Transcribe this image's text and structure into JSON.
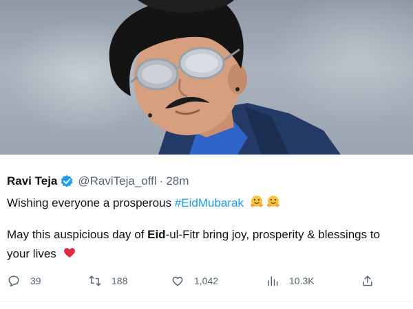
{
  "tweet": {
    "author_name": "Ravi Teja",
    "handle": "@RaviTeja_offl",
    "separator": "·",
    "time": "28m",
    "line1_text": "Wishing everyone a prosperous ",
    "line1_hashtag": "#EidMubarak",
    "line2_pre": "May this auspicious day of ",
    "line2_bold": "Eid",
    "line2_post": "-ul-Fitr bring joy, prosperity & blessings to",
    "line3_text": "your lives"
  },
  "actions": {
    "replies": "39",
    "retweets": "188",
    "likes": "1,042",
    "views": "10.3K"
  },
  "colors": {
    "link": "#1d9bf0",
    "muted": "#536471",
    "text": "#0f1419",
    "heart": "#e0245e"
  },
  "icons": {
    "verified": "verified-badge-icon",
    "emoji": "hugging-face-emoji",
    "heart_emoji": "red-heart-emoji",
    "reply": "reply-icon",
    "retweet": "retweet-icon",
    "like": "like-icon",
    "views": "views-icon",
    "share": "share-icon"
  }
}
